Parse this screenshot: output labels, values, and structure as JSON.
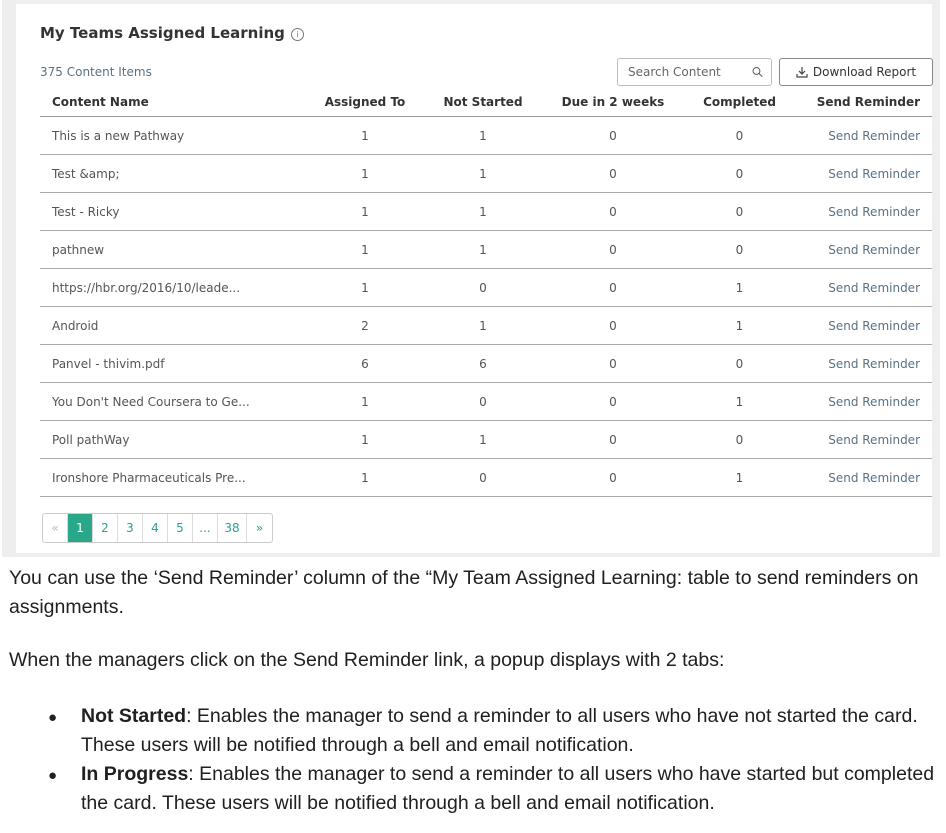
{
  "panel": {
    "title": "My Teams Assigned Learning",
    "info_icon": "info-circle-icon",
    "count_label": "375 Content Items",
    "search_placeholder": "Search Content",
    "download_label": "Download Report",
    "colors": {
      "accent": "#29a889",
      "link": "#5a7184"
    }
  },
  "table": {
    "headers": [
      "Content Name",
      "Assigned To",
      "Not Started",
      "Due in 2 weeks",
      "Completed",
      "Send Reminder"
    ],
    "rows": [
      {
        "name": "This is a new Pathway",
        "assigned": "1",
        "not_started": "1",
        "due": "0",
        "completed": "0",
        "action": "Send Reminder"
      },
      {
        "name": "Test &amp;",
        "assigned": "1",
        "not_started": "1",
        "due": "0",
        "completed": "0",
        "action": "Send Reminder"
      },
      {
        "name": "Test - Ricky",
        "assigned": "1",
        "not_started": "1",
        "due": "0",
        "completed": "0",
        "action": "Send Reminder"
      },
      {
        "name": "pathnew",
        "assigned": "1",
        "not_started": "1",
        "due": "0",
        "completed": "0",
        "action": "Send Reminder"
      },
      {
        "name": "https://hbr.org/2016/10/leade...",
        "assigned": "1",
        "not_started": "0",
        "due": "0",
        "completed": "1",
        "action": "Send Reminder"
      },
      {
        "name": "Android",
        "assigned": "2",
        "not_started": "1",
        "due": "0",
        "completed": "1",
        "action": "Send Reminder"
      },
      {
        "name": "Panvel - thivim.pdf",
        "assigned": "6",
        "not_started": "6",
        "due": "0",
        "completed": "0",
        "action": "Send Reminder"
      },
      {
        "name": "You Don't Need Coursera to Ge...",
        "assigned": "1",
        "not_started": "0",
        "due": "0",
        "completed": "1",
        "action": "Send Reminder"
      },
      {
        "name": "Poll pathWay",
        "assigned": "1",
        "not_started": "1",
        "due": "0",
        "completed": "0",
        "action": "Send Reminder"
      },
      {
        "name": "Ironshore Pharmaceuticals Pre...",
        "assigned": "1",
        "not_started": "0",
        "due": "0",
        "completed": "1",
        "action": "Send Reminder"
      }
    ]
  },
  "pagination": {
    "prev": "«",
    "pages": [
      "1",
      "2",
      "3",
      "4",
      "5",
      "...",
      "38"
    ],
    "active": "1",
    "next": "»"
  },
  "doc": {
    "paragraph1": "You can use the ‘Send Reminder’ column  of the “My Team Assigned Learning: table to send reminders on assignments.",
    "paragraph2": "When the managers click on the Send Reminder link,  a popup displays with 2 tabs:",
    "bullets": [
      {
        "term": "Not Started",
        "text": ": Enables the manager to send a reminder to all users who have not started the card. These users will be notified through a bell and email notification."
      },
      {
        "term": "In Progress",
        "text": ": Enables the manager to send a reminder to all users who have started but completed the card. These users will be notified through a bell and email notification."
      }
    ]
  }
}
